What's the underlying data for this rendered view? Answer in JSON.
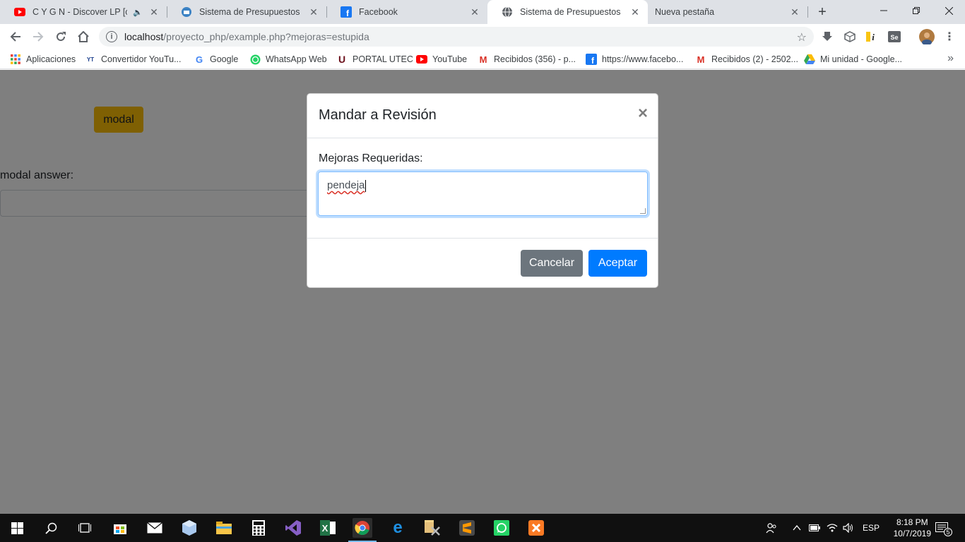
{
  "browser": {
    "tabs": [
      {
        "title": "C Y G N - Discover LP [chill",
        "favicon": "youtube-icon",
        "audio": true
      },
      {
        "title": "Sistema de Presupuestos",
        "favicon": "app-icon"
      },
      {
        "title": "Facebook",
        "favicon": "facebook-icon"
      },
      {
        "title": "Sistema de Presupuestos",
        "favicon": "globe-icon",
        "active": true
      },
      {
        "title": "Nueva pestaña",
        "favicon": ""
      }
    ],
    "url_host": "localhost",
    "url_path": "/proyecto_php/example.php?mejoras=estupida",
    "bookmarks": [
      {
        "label": "Aplicaciones",
        "icon": "apps-grid-icon"
      },
      {
        "label": "Convertidor YouTu...",
        "icon": "ytmp3-icon"
      },
      {
        "label": "Google",
        "icon": "google-icon"
      },
      {
        "label": "WhatsApp Web",
        "icon": "whatsapp-icon"
      },
      {
        "label": "PORTAL UTEC",
        "icon": "utec-icon"
      },
      {
        "label": "YouTube",
        "icon": "youtube-icon"
      },
      {
        "label": "Recibidos (356) - p...",
        "icon": "gmail-icon"
      },
      {
        "label": "https://www.facebo...",
        "icon": "facebook-icon"
      },
      {
        "label": "Recibidos (2) - 2502...",
        "icon": "gmail-icon"
      },
      {
        "label": "Mi unidad - Google...",
        "icon": "drive-icon"
      }
    ]
  },
  "page": {
    "modal_button": "modal",
    "answer_label": "modal answer:"
  },
  "modal": {
    "title": "Mandar a Revisión",
    "close": "×",
    "field_label": "Mejoras Requeridas:",
    "field_value": "pendeja",
    "cancel": "Cancelar",
    "accept": "Aceptar"
  },
  "taskbar": {
    "time": "8:18 PM",
    "date": "10/7/2019",
    "language": "ESP",
    "notifications": "5"
  },
  "colors": {
    "primary": "#007bff",
    "secondary": "#6c757d",
    "warning": "#ffc107"
  }
}
